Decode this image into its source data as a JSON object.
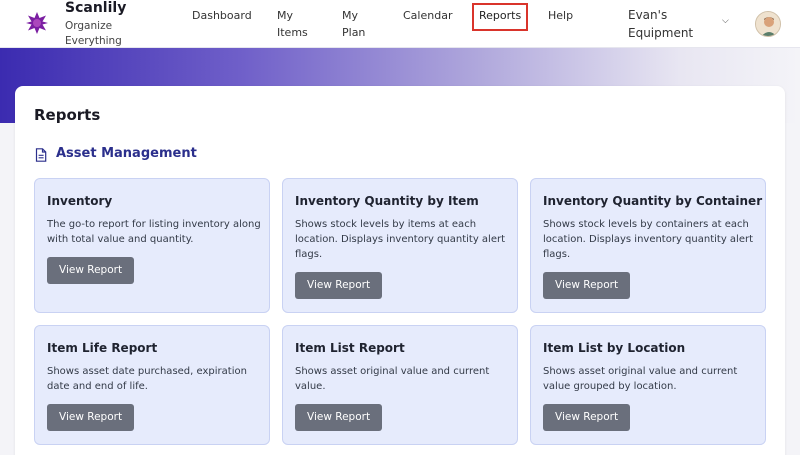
{
  "brand": {
    "name": "Scanlily",
    "tagline": "Organize Everything"
  },
  "nav": [
    {
      "label": "Dashboard",
      "active": false
    },
    {
      "label": "My Items",
      "active": false
    },
    {
      "label": "My Plan",
      "active": false
    },
    {
      "label": "Calendar",
      "active": false
    },
    {
      "label": "Reports",
      "active": true
    },
    {
      "label": "Help",
      "active": false
    }
  ],
  "account": {
    "name": "Evan's Equipment"
  },
  "page": {
    "title": "Reports"
  },
  "section": {
    "title": "Asset Management"
  },
  "cards": [
    {
      "title": "Inventory",
      "description": "The go-to report for listing inventory along with total value and quantity.",
      "button": "View Report"
    },
    {
      "title": "Inventory Quantity by Item",
      "description": "Shows stock levels by items at each location. Displays inventory quantity alert flags.",
      "button": "View Report"
    },
    {
      "title": "Inventory Quantity by Container",
      "description": "Shows stock levels by containers at each location. Displays inventory quantity alert flags.",
      "button": "View Report"
    },
    {
      "title": "Item Life Report",
      "description": "Shows asset date purchased, expiration date and end of life.",
      "button": "View Report"
    },
    {
      "title": "Item List Report",
      "description": "Shows asset original value and current value.",
      "button": "View Report"
    },
    {
      "title": "Item List by Location",
      "description": "Shows asset original value and current value grouped by location.",
      "button": "View Report"
    }
  ],
  "colors": {
    "accent": "#2b2f8c",
    "card_bg": "#e6ebfc",
    "button_bg": "#6a6f7c",
    "active_outline": "#d9342b"
  },
  "icons": {
    "logo": "scanlily-logo-icon",
    "section": "document-icon",
    "account": "chevron-down-icon"
  }
}
